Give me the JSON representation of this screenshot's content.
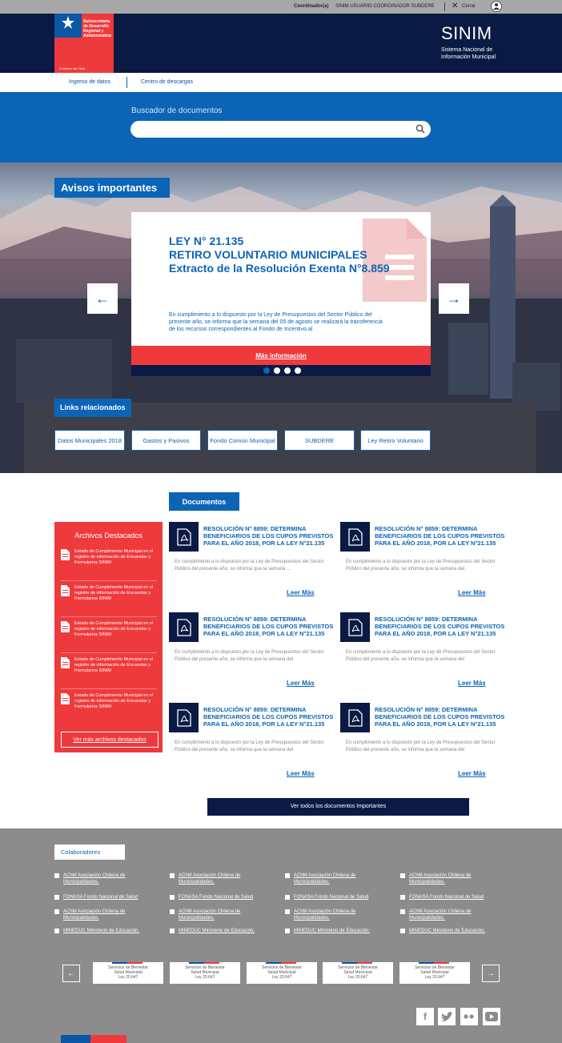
{
  "topbar": {
    "coordinator_label": "Coordinador(a)",
    "user_name": "SINIM USUARIO COORDINADOR SUBDERE",
    "logout": "Cerrar"
  },
  "logo": {
    "text": "Subsecretaría de Desarrollo Regional y Administrativo",
    "footer": "Gobierno de Chile"
  },
  "brand": {
    "title": "SINIM",
    "subtitle_line1": "Sistema Nacional de",
    "subtitle_line2": "Información Municipal"
  },
  "nav": {
    "items": [
      "Ingreso de datos",
      "Centro de descargas"
    ]
  },
  "search": {
    "label": "Buscador de documentos",
    "placeholder": ""
  },
  "avisos": {
    "title": "Avisos importantes",
    "card": {
      "line1": "LEY N° 21.135",
      "line2": "RETIRO VOLUNTARIO MUNICIPALES",
      "line3": "Extracto de la Resolución Exenta N°8.859",
      "body": "En cumplimiento a lo dispuesto por la Ley de Presupuestos del Sector Público del presente año, se informa que la semana del 05 de agosto se realizará la transferencia de los recursos correspondientes al Fondo de Incentivo al",
      "more": "Más información"
    },
    "slides": 4,
    "active_slide": 1
  },
  "links": {
    "title": "Links relacionados",
    "items": [
      "Datos Municipales 2018",
      "Gastos y Pasivos",
      "Fondo Común Municipal",
      "SUBDERE",
      "Ley Retiro Voluntario"
    ]
  },
  "documentos": {
    "title": "Documentos",
    "items": [
      {
        "title": "RESOLUCIÓN N° 8859: DETERMINA BENEFICIARIOS DE LOS CUPOS PREVISTOS PARA EL AÑO 2018, POR LA LEY N°21.135",
        "desc": "En cumplimiento a lo dispuesto por la Ley de Presupuestos del Sector Público del presente año, se informa que la semana ...",
        "more": "Leer Más"
      },
      {
        "title": "RESOLUCIÓN N° 8859: DETERMINA BENEFICIARIOS DE LOS CUPOS PREVISTOS PARA EL AÑO 2018, POR LA LEY N°21.135",
        "desc": "En cumplimiento a lo dispuesto por la Ley de Presupuestos del Sector Público del presente año, se informa que la semana del",
        "more": "Leer Más"
      },
      {
        "title": "RESOLUCIÓN N° 8859: DETERMINA BENEFICIARIOS DE LOS CUPOS PREVISTOS PARA EL AÑO 2018, POR LA LEY N°21.135",
        "desc": "En cumplimiento a lo dispuesto por la Ley de Presupuestos del Sector Público del presente año, se informa que la semana del",
        "more": "Leer Más"
      },
      {
        "title": "RESOLUCIÓN N° 8859: DETERMINA BENEFICIARIOS DE LOS CUPOS PREVISTOS PARA EL AÑO 2018, POR LA LEY N°21.135",
        "desc": "En cumplimiento a lo dispuesto por la Ley de Presupuestos del Sector Público del presente año, se informa que la semana del",
        "more": "Leer Más"
      },
      {
        "title": "RESOLUCIÓN N° 8859: DETERMINA BENEFICIARIOS DE LOS CUPOS PREVISTOS PARA EL AÑO 2018, POR LA LEY N°21.135",
        "desc": "En cumplimiento a lo dispuesto por la Ley de Presupuestos del Sector Público del presente año, se informa que la semana del",
        "more": "Leer Más"
      },
      {
        "title": "RESOLUCIÓN N° 8859: DETERMINA BENEFICIARIOS DE LOS CUPOS PREVISTOS PARA EL AÑO 2018, POR LA LEY N°21.135",
        "desc": "En cumplimiento a lo dispuesto por la Ley de Presupuestos del Sector Público del presente año, se informa que la semana del",
        "more": "Leer Más"
      }
    ],
    "all_button": "Ver todos los documentos Importantes"
  },
  "archivos": {
    "title": "Archivos Destacados",
    "items": [
      "Estado de Cumplimiento Municipal en el registro de información de Encuestas y Formularios SINIM",
      "Estado de Cumplimiento Municipal en el registro de información de Encuestas y Formularios SINIM",
      "Estado de Cumplimiento Municipal en el registro de información de Encuestas y Formularios SINIM",
      "Estado de Cumplimiento Municipal en el registro de información de Encuestas y Formularios SINIM",
      "Estado de Cumplimiento Municipal en el registro de información de Encuestas y Formularios SINIM"
    ],
    "more": "Ver más archivos destacados"
  },
  "colaboradores": {
    "title": "Colaboradores",
    "rows": [
      [
        "AChM Asociación Chilena de Municipalidades.",
        "AChM Asociación Chilena de Municipalidades.",
        "AChM Asociación Chilena de Municipalidades.",
        "AChM Asociación Chilena de Municipalidades."
      ],
      [
        "FONASA Fondo Nacional de Salud",
        "FONASA Fondo Nacional de Salud",
        "FONASA Fondo Nacional de Salud",
        "FONASA Fondo Nacional de Salud"
      ],
      [
        "AChM Asociación Chilena de Municipalidades.",
        "AChM Asociación Chilena de Municipalidades.",
        "AChM Asociación Chilena de Municipalidades.",
        "AChM Asociación Chilena de Municipalidades."
      ],
      [
        "MINEDUC Ministerio de Educación.",
        "MINEDUC Ministerio de Educación.",
        "MINEDUC Ministerio de Educación.",
        "MINEDUC Ministerio de Educación."
      ]
    ],
    "logos": [
      {
        "l1": "Servicios de Bienestar",
        "l2": "Salud Municipal",
        "l3": "Ley 20.647"
      },
      {
        "l1": "Servicios de Bienestar",
        "l2": "Salud Municipal",
        "l3": "Ley 20.647"
      },
      {
        "l1": "Servicios de Bienestar",
        "l2": "Salud Municipal",
        "l3": "Ley 20.647"
      },
      {
        "l1": "Servicios de Bienestar",
        "l2": "Salud Municipal",
        "l3": "Ley 20.647"
      },
      {
        "l1": "Servicios de Bienestar",
        "l2": "Salud Municipal",
        "l3": "Ley 20.647"
      }
    ]
  },
  "social": [
    "facebook-icon",
    "twitter-icon",
    "flickr-icon",
    "youtube-icon"
  ],
  "colors": {
    "navy": "#0b1a44",
    "blue": "#0b64b6",
    "red": "#ee3a3c",
    "gray": "#8c8c8c"
  }
}
